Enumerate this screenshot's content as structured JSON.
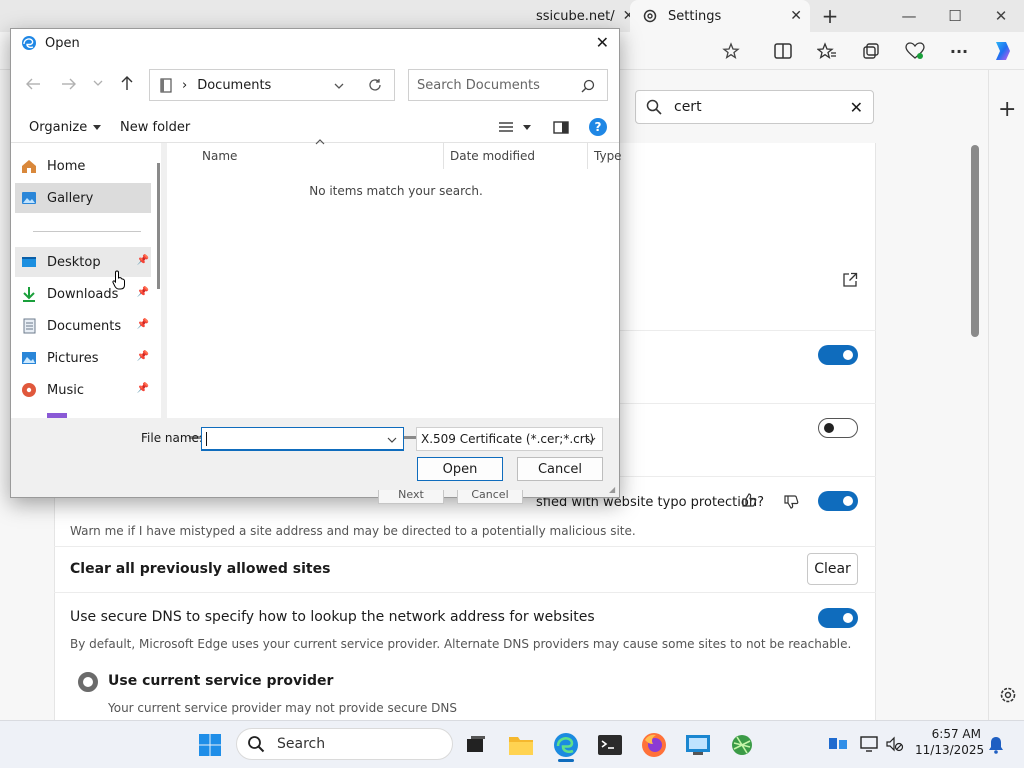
{
  "browser": {
    "tabs": [
      {
        "label": "ssicube.net/"
      },
      {
        "label": "Settings"
      }
    ],
    "new_tab": "+",
    "window_controls": {
      "minimize": "—",
      "maximize": "☐",
      "close": "✕"
    }
  },
  "settings": {
    "search": {
      "value": "cert"
    },
    "typo_prompt": "sfied with website typo protection?",
    "typo_desc": "Warn me if I have mistyped a site address and may be directed to a potentially malicious site.",
    "clear_sites_label": "Clear all previously allowed sites",
    "clear_button": "Clear",
    "secure_dns_label": "Use secure DNS to specify how to lookup the network address for websites",
    "secure_dns_desc": "By default, Microsoft Edge uses your current service provider. Alternate DNS providers may cause some sites to not be reachable.",
    "current_provider_label": "Use current service provider",
    "current_provider_desc": "Your current service provider may not provide secure DNS",
    "behind_next": "Next",
    "behind_cancel": "Cancel",
    "toggles": {
      "t1": "on",
      "t2": "off",
      "t3": "on",
      "t4": "on"
    }
  },
  "dialog": {
    "title": "Open",
    "address": {
      "separator": "›",
      "location": "Documents"
    },
    "search_placeholder": "Search Documents",
    "organize": "Organize",
    "new_folder": "New folder",
    "nav_items": [
      {
        "label": "Home"
      },
      {
        "label": "Gallery"
      },
      {
        "label": "Desktop"
      },
      {
        "label": "Downloads"
      },
      {
        "label": "Documents"
      },
      {
        "label": "Pictures"
      },
      {
        "label": "Music"
      }
    ],
    "columns": {
      "name": "Name",
      "date": "Date modified",
      "type": "Type"
    },
    "empty_message": "No items match your search.",
    "file_name_label": "File name:",
    "file_name_value": "",
    "file_type": "X.509 Certificate (*.cer;*.crt)",
    "open_button": "Open",
    "cancel_button": "Cancel"
  },
  "taskbar": {
    "search_label": "Search",
    "time": "6:57 AM",
    "date": "11/13/2025"
  },
  "colors": {
    "accent": "#0f6cbd",
    "help": "#1f87e5"
  }
}
